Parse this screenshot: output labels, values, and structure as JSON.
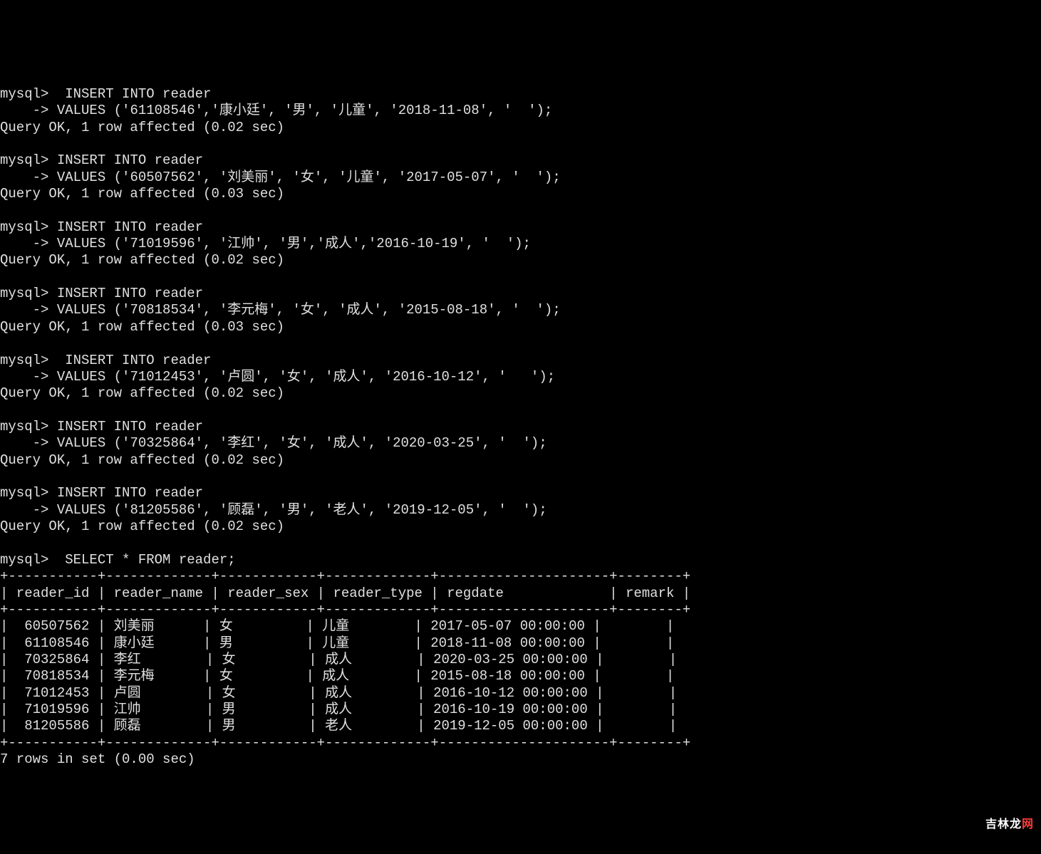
{
  "prompts": {
    "mysql": "mysql>",
    "cont": "    ->"
  },
  "results": {
    "ok002": "Query OK, 1 row affected (0.02 sec)",
    "ok003": "Query OK, 1 row affected (0.03 sec)",
    "rows7": "7 rows in set (0.00 sec)"
  },
  "inserts": [
    {
      "cmd": " INSERT INTO reader",
      "values": "VALUES ('61108546','康小廷', '男', '儿童', '2018-11-08', '  ');",
      "resultKey": "ok002"
    },
    {
      "cmd": "INSERT INTO reader",
      "values": "VALUES ('60507562', '刘美丽', '女', '儿童', '2017-05-07', '  ');",
      "resultKey": "ok003"
    },
    {
      "cmd": "INSERT INTO reader",
      "values": "VALUES ('71019596', '江帅', '男','成人','2016-10-19', '  ');",
      "resultKey": "ok002"
    },
    {
      "cmd": "INSERT INTO reader",
      "values": "VALUES ('70818534', '李元梅', '女', '成人', '2015-08-18', '  ');",
      "resultKey": "ok003"
    },
    {
      "cmd": " INSERT INTO reader",
      "values": "VALUES ('71012453', '卢圆', '女', '成人', '2016-10-12', '   ');",
      "resultKey": "ok002"
    },
    {
      "cmd": "INSERT INTO reader",
      "values": "VALUES ('70325864', '李红', '女', '成人', '2020-03-25', '  ');",
      "resultKey": "ok002"
    },
    {
      "cmd": "INSERT INTO reader",
      "values": "VALUES ('81205586', '顾磊', '男', '老人', '2019-12-05', '  ');",
      "resultKey": "ok002"
    }
  ],
  "select": {
    "cmd": " SELECT * FROM reader;"
  },
  "table": {
    "border": "+-----------+-------------+------------+-------------+---------------------+--------+",
    "header": "| reader_id | reader_name | reader_sex | reader_type | regdate             | remark |",
    "rows": [
      "|  60507562 | 刘美丽      | 女         | 儿童        | 2017-05-07 00:00:00 |        |",
      "|  61108546 | 康小廷      | 男         | 儿童        | 2018-11-08 00:00:00 |        |",
      "|  70325864 | 李红        | 女         | 成人        | 2020-03-25 00:00:00 |        |",
      "|  70818534 | 李元梅      | 女         | 成人        | 2015-08-18 00:00:00 |        |",
      "|  71012453 | 卢圆        | 女         | 成人        | 2016-10-12 00:00:00 |        |",
      "|  71019596 | 江帅        | 男         | 成人        | 2016-10-19 00:00:00 |        |",
      "|  81205586 | 顾磊        | 男         | 老人        | 2019-12-05 00:00:00 |        |"
    ]
  },
  "watermark": {
    "main": "吉林龙",
    "accent": "网"
  }
}
